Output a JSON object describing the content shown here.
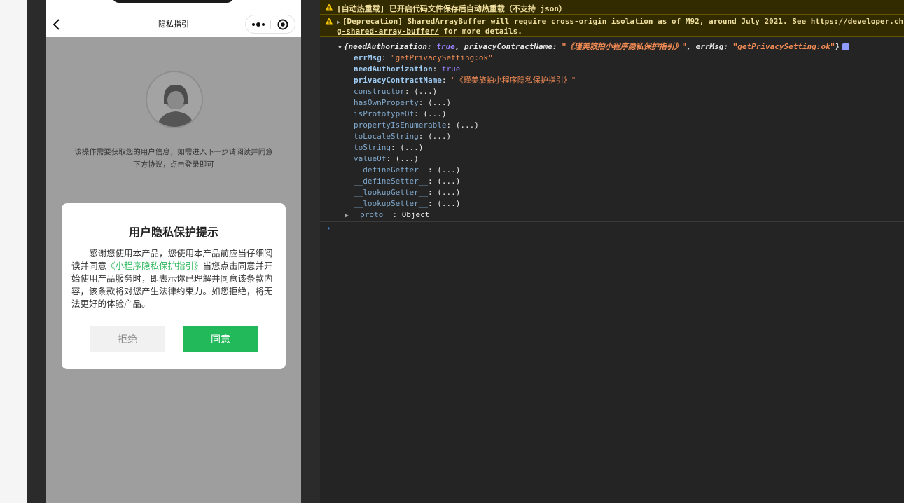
{
  "simulator": {
    "nav_title": "隐私指引",
    "page_message": "该操作需要获取您的用户信息，如需进入下一步请阅读并同意下方协议，点击登录即可",
    "dialog": {
      "title": "用户隐私保护提示",
      "body_before": "感谢您使用本产品，您使用本产品前应当仔细阅读并同意",
      "link_text": "《小程序隐私保护指引》",
      "body_after": "当您点击同意并开始使用产品服务时，即表示你已理解并同意该条款内容，该条款将对您产生法律约束力。如您拒绝，将无法更好的体验产品。",
      "reject_label": "拒绝",
      "agree_label": "同意"
    }
  },
  "console": {
    "warning_1": "[自动热重载] 已开启代码文件保存后自动热重载（不支持 json）",
    "warning_2_line1": "[Deprecation] SharedArrayBuffer will require cross-origin isolation as of M92, around July 2021. See ",
    "warning_2_link1": "https://developer.ch",
    "warning_2_link2": "g-shared-array-buffer/",
    "warning_2_line2": " for more details.",
    "summary": {
      "open": "{",
      "k1": "needAuthorization",
      "v1": "true",
      "k2": "privacyContractName",
      "v2": "\"《瑾美旅拍小程序隐私保护指引》\"",
      "k3": "errMsg",
      "v3": "\"getPrivacySetting:ok\"",
      "close": "}"
    },
    "props": [
      {
        "key": "errMsg",
        "value": "\"getPrivacySetting:ok\"",
        "kind": "str"
      },
      {
        "key": "needAuthorization",
        "value": "true",
        "kind": "bool"
      },
      {
        "key": "privacyContractName",
        "value": "\"《瑾美旅拍小程序隐私保护指引》\"",
        "kind": "str"
      }
    ],
    "methods": [
      "constructor",
      "hasOwnProperty",
      "isPrototypeOf",
      "propertyIsEnumerable",
      "toLocaleString",
      "toString",
      "valueOf",
      "__defineGetter__",
      "__defineSetter__",
      "__lookupGetter__",
      "__lookupSetter__"
    ],
    "method_value": "(...)",
    "proto_key": "__proto__",
    "proto_value": "Object",
    "prompt": "›"
  }
}
